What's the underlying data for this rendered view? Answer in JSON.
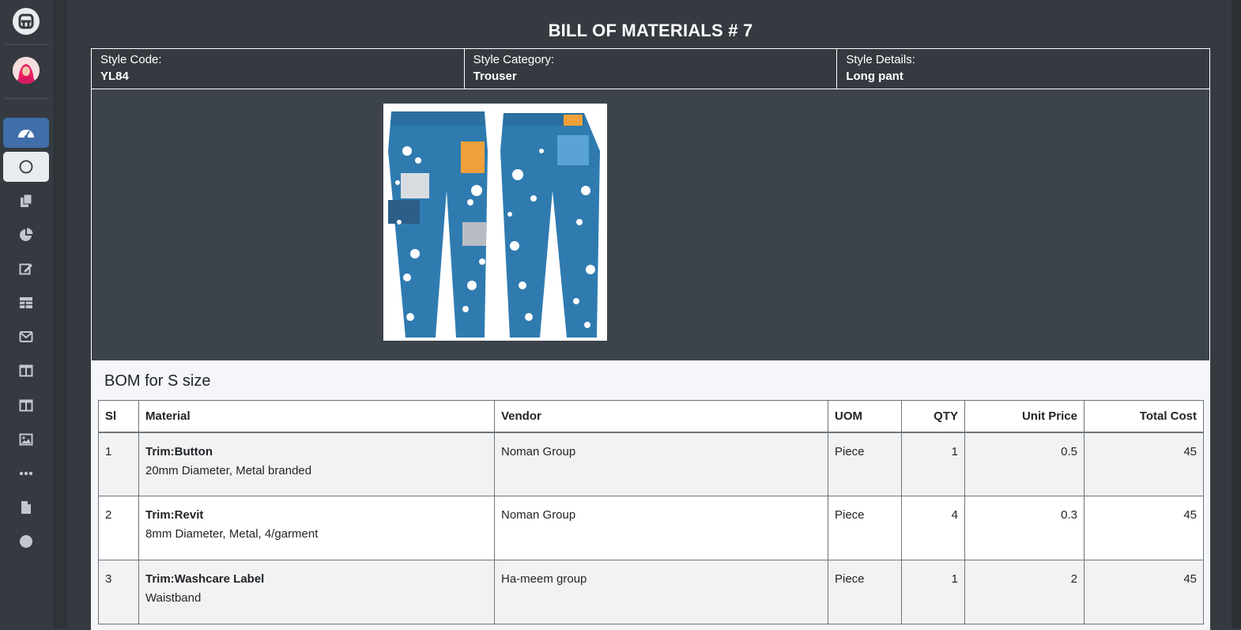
{
  "sidebar": {
    "logo_icon": "app-logo-icon",
    "avatar": "user-avatar",
    "items": [
      {
        "icon": "tachometer-icon",
        "state": "active"
      },
      {
        "icon": "circle-outline-icon",
        "state": "light"
      },
      {
        "icon": "copy-icon"
      },
      {
        "icon": "chart-pie-icon"
      },
      {
        "icon": "edit-icon"
      },
      {
        "icon": "table-icon"
      },
      {
        "icon": "envelope-icon"
      },
      {
        "icon": "columns-icon"
      },
      {
        "icon": "columns-icon"
      },
      {
        "icon": "image-icon"
      },
      {
        "icon": "ellipsis-icon"
      },
      {
        "icon": "file-icon"
      },
      {
        "icon": "circle-filled-icon"
      }
    ]
  },
  "page": {
    "title": "BILL OF MATERIALS # 7"
  },
  "style_info": {
    "code_label": "Style Code:",
    "code_value": "YL84",
    "category_label": "Style Category:",
    "category_value": "Trouser",
    "details_label": "Style Details:",
    "details_value": "Long pant"
  },
  "bom": {
    "title": "BOM for S size",
    "columns": {
      "sl": "Sl",
      "material": "Material",
      "vendor": "Vendor",
      "uom": "UOM",
      "qty": "QTY",
      "unit_price": "Unit Price",
      "total_cost": "Total Cost"
    },
    "rows": [
      {
        "sl": "1",
        "name": "Trim:Button",
        "desc": "20mm Diameter, Metal branded",
        "vendor": "Noman Group",
        "uom": "Piece",
        "qty": "1",
        "unit_price": "0.5",
        "total_cost": "45"
      },
      {
        "sl": "2",
        "name": "Trim:Revit",
        "desc": "8mm Diameter, Metal, 4/garment",
        "vendor": "Noman Group",
        "uom": "Piece",
        "qty": "4",
        "unit_price": "0.3",
        "total_cost": "45"
      },
      {
        "sl": "3",
        "name": "Trim:Washcare Label",
        "desc": "Waistband",
        "vendor": "Ha-meem group",
        "uom": "Piece",
        "qty": "1",
        "unit_price": "2",
        "total_cost": "45"
      }
    ]
  }
}
